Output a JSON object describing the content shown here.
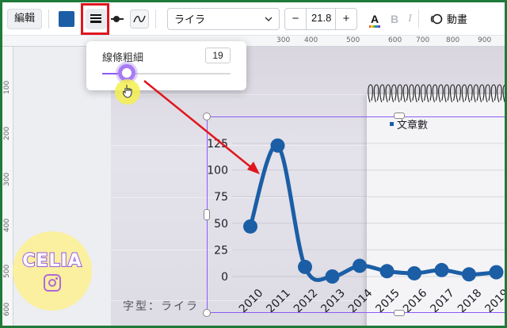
{
  "toolbar": {
    "edit_label": "編輯",
    "color": "#1b5ea6",
    "line_weight_icon": "line-weight-icon",
    "line_style_icon": "line-dot-icon",
    "curve_icon": "curve-line-icon",
    "font_name": "ライラ",
    "font_size_value": "21.8",
    "decrease": "−",
    "increase": "+",
    "text_color_label": "A",
    "bold_label": "B",
    "italic_label": "I",
    "animate_label": "動畫"
  },
  "rulers": {
    "top": [
      "300",
      "400",
      "500",
      "600",
      "700",
      "800",
      "900"
    ],
    "left": [
      "100",
      "200",
      "300",
      "400",
      "500",
      "600"
    ]
  },
  "popup": {
    "title": "線條粗細",
    "value": "19",
    "slider_fraction": 0.19
  },
  "font_note": "字型：ライラ",
  "watermark": {
    "text": "CELIA",
    "icon": "instagram-icon"
  },
  "chart_data": {
    "type": "line",
    "legend": [
      "文章數"
    ],
    "legend_position": "top",
    "categories": [
      "2010",
      "2011",
      "2012",
      "2013",
      "2014",
      "2015",
      "2016",
      "2017",
      "2018",
      "2019"
    ],
    "series": [
      {
        "name": "文章數",
        "values": [
          47,
          123,
          9,
          0,
          10,
          5,
          3,
          6,
          2,
          4
        ],
        "color": "#1b5ea6"
      }
    ],
    "y_ticks": [
      "0",
      "25",
      "50",
      "75",
      "100",
      "125"
    ],
    "ylim": [
      0,
      125
    ],
    "smooth": true,
    "grid": true
  },
  "colors": {
    "highlight": "#e0161e",
    "selection": "#8b5cf6",
    "frame": "#1f7a3a",
    "series": "#1b5ea6"
  }
}
